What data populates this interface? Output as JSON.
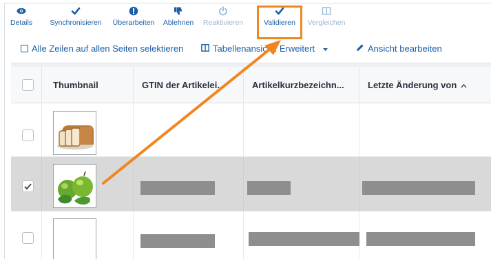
{
  "toolbar": {
    "buttons": [
      {
        "label": "Details",
        "icon": "eye-icon",
        "disabled": false
      },
      {
        "label": "Synchronisieren",
        "icon": "checkmark-icon",
        "disabled": false
      },
      {
        "label": "Überarbeiten",
        "icon": "alert-icon",
        "disabled": false
      },
      {
        "label": "Ablehnen",
        "icon": "thumbs-down-icon",
        "disabled": false
      },
      {
        "label": "Reaktivieren",
        "icon": "power-icon",
        "disabled": true
      },
      {
        "label": "Validieren",
        "icon": "checkmark-icon",
        "disabled": false
      },
      {
        "label": "Vergleichen",
        "icon": "compare-columns-icon",
        "disabled": true
      }
    ]
  },
  "actions": {
    "select_all": "Alle Zeilen auf allen Seiten selektieren",
    "table_view": "Tabellenansicht: Erweitert",
    "edit_view": "Ansicht bearbeiten"
  },
  "table": {
    "columns": [
      "Thumbnail",
      "GTIN der Artikelei...",
      "Artikelkurzbezeichn...",
      "Letzte Änderung von"
    ],
    "sort_indicator": "^",
    "rows": [
      {
        "selected": false,
        "thumbnail": "bread-image",
        "values": [
          "",
          "",
          ""
        ]
      },
      {
        "selected": true,
        "thumbnail": "green-apples-image",
        "values": [
          "[redacted]",
          "[redacted]",
          "[redacted]"
        ]
      },
      {
        "selected": false,
        "thumbnail": "blank-image",
        "values": [
          "[redacted]",
          "[redacted]",
          "[redacted]"
        ]
      }
    ]
  },
  "colors": {
    "accent": "#1a5fa8",
    "highlight": "#f0871e",
    "selected_row": "#d9d9d9",
    "redaction": "#8e8e8e"
  }
}
